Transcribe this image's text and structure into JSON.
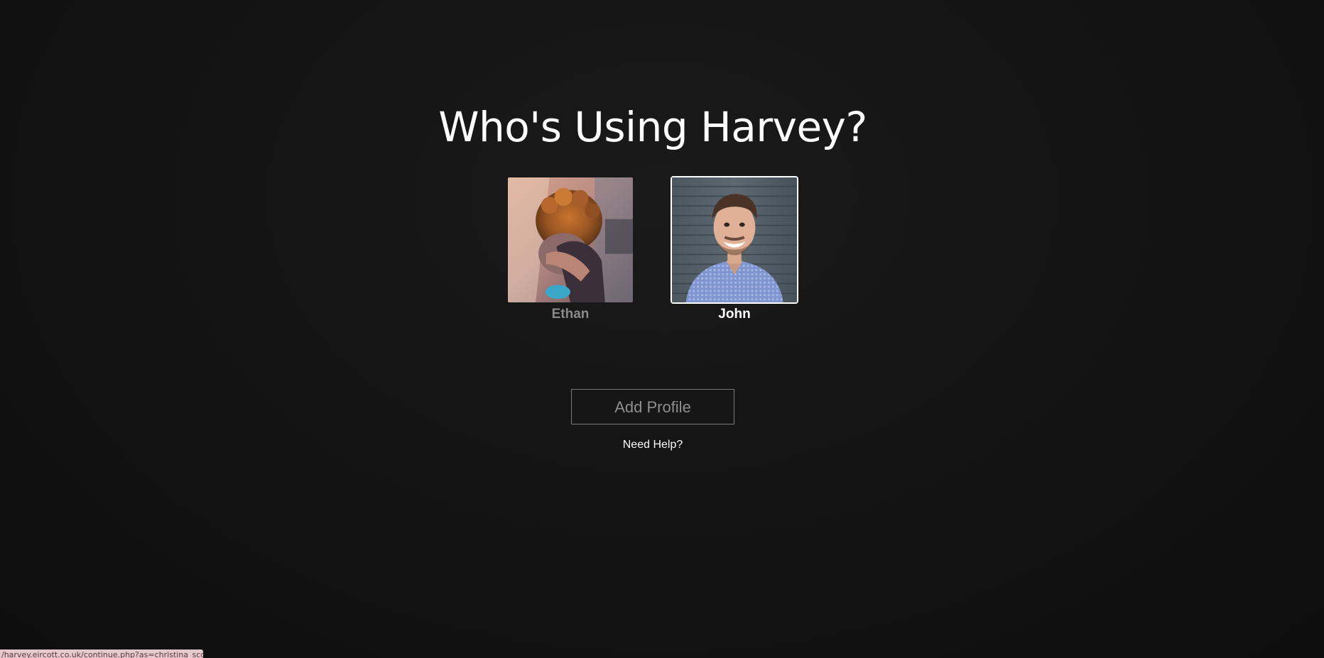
{
  "header": {
    "title": "Who's Using Harvey?"
  },
  "profiles": [
    {
      "name": "Ethan",
      "active": false,
      "avatar_icon": "profile-photo-ethan"
    },
    {
      "name": "John",
      "active": true,
      "avatar_icon": "profile-photo-john"
    }
  ],
  "actions": {
    "add_profile_label": "Add Profile",
    "help_link_label": "Need Help?"
  },
  "status_bar": {
    "url": "/harvey.eircott.co.uk/continue.php?as=christina_scott"
  },
  "colors": {
    "background": "#131313",
    "text_primary": "#ffffff",
    "text_muted": "#8a8a8a",
    "button_border": "#7a7a7a",
    "status_bar_bg": "#e6c8cf"
  }
}
